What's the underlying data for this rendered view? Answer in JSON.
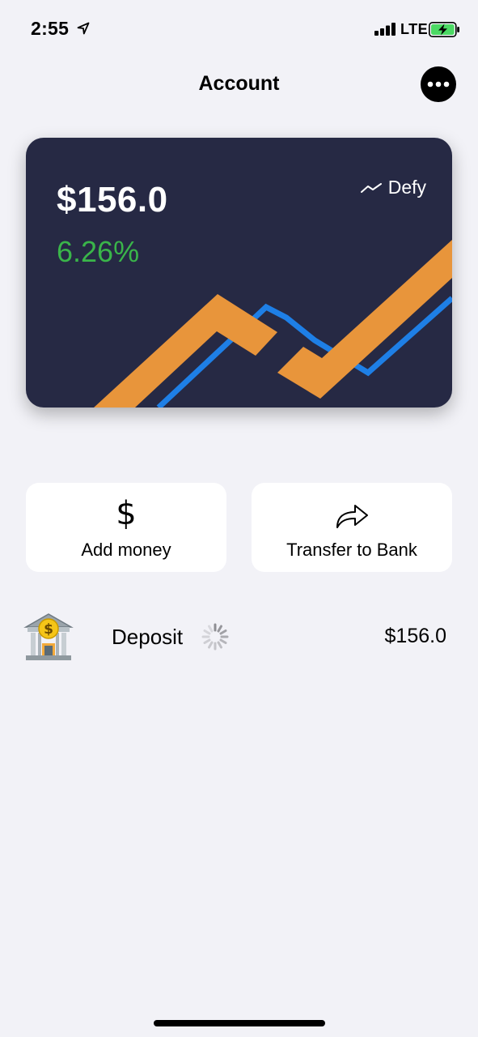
{
  "status_bar": {
    "time": "2:55",
    "network": "LTE",
    "location_icon": "location-arrow-icon",
    "signal_icon": "cellular-signal-icon",
    "battery_icon": "battery-charging-icon"
  },
  "header": {
    "title": "Account",
    "more_icon": "more-dots-icon"
  },
  "card": {
    "balance": "$156.0",
    "change": "6.26%",
    "brand": "Defy",
    "colors": {
      "background": "#262944",
      "accent_orange": "#e8953b",
      "accent_blue": "#1e7fe6",
      "positive": "#3ab54a"
    }
  },
  "actions": {
    "add_money": {
      "label": "Add money",
      "icon": "dollar-icon"
    },
    "transfer": {
      "label": "Transfer to Bank",
      "icon": "share-arrow-icon"
    }
  },
  "transactions": [
    {
      "label": "Deposit",
      "amount": "$156.0",
      "icon": "bank-icon",
      "status_icon": "loading-spinner-icon"
    }
  ]
}
